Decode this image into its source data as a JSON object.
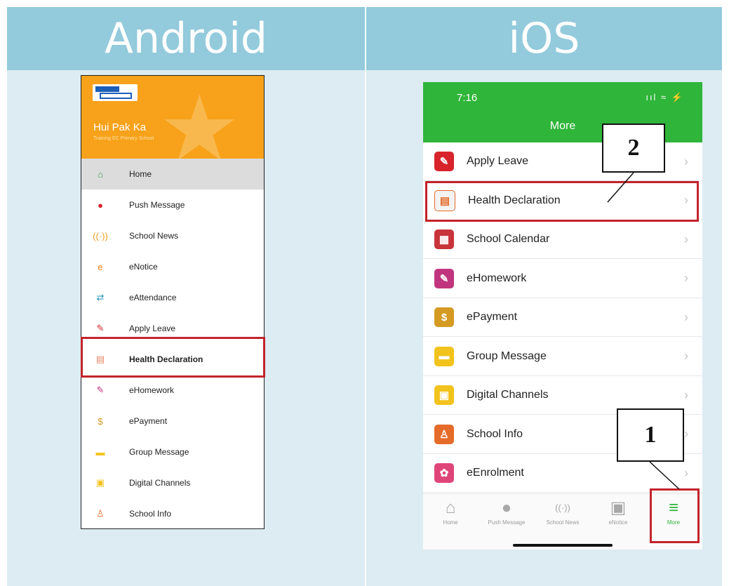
{
  "headers": {
    "android": "Android",
    "ios": "iOS"
  },
  "android": {
    "user_name": "Hui Pak Ka",
    "school_name": "Training EC Primary School",
    "menu": [
      {
        "label": "Home",
        "icon": "home-icon",
        "color": "#3aa655",
        "glyph": "⌂",
        "selected": true
      },
      {
        "label": "Push Message",
        "icon": "push-message-icon",
        "color": "#d8232a",
        "glyph": "●"
      },
      {
        "label": "School News",
        "icon": "school-news-icon",
        "color": "#f0a020",
        "glyph": "((·))"
      },
      {
        "label": "eNotice",
        "icon": "enotice-icon",
        "color": "#f07a1a",
        "glyph": "e"
      },
      {
        "label": "eAttendance",
        "icon": "eattendance-icon",
        "color": "#1f8fb5",
        "glyph": "⇄"
      },
      {
        "label": "Apply Leave",
        "icon": "apply-leave-icon",
        "color": "#d8232a",
        "glyph": "✎"
      },
      {
        "label": "Health Declaration",
        "icon": "health-declaration-icon",
        "color": "#e8876a",
        "glyph": "▤",
        "highlighted": true
      },
      {
        "label": "eHomework",
        "icon": "ehomework-icon",
        "color": "#c0357e",
        "glyph": "✎"
      },
      {
        "label": "ePayment",
        "icon": "epayment-icon",
        "color": "#d49a22",
        "glyph": "$"
      },
      {
        "label": "Group Message",
        "icon": "group-message-icon",
        "color": "#f2c31d",
        "glyph": "▬"
      },
      {
        "label": "Digital Channels",
        "icon": "digital-channels-icon",
        "color": "#f2c31d",
        "glyph": "▣"
      },
      {
        "label": "School Info",
        "icon": "school-info-icon",
        "color": "#e56b2a",
        "glyph": "♙"
      }
    ]
  },
  "ios": {
    "time": "7:16",
    "status_icons": "ııl ≈ ⚡",
    "title": "More",
    "rows": [
      {
        "label": "Apply Leave",
        "icon": "apply-leave-icon",
        "color": "#d8232a",
        "glyph": "✎"
      },
      {
        "label": "Health Declaration",
        "icon": "health-declaration-icon",
        "color": "#f3f3f3",
        "glyph": "▤",
        "highlighted": true
      },
      {
        "label": "School Calendar",
        "icon": "school-calendar-icon",
        "color": "#c7343a",
        "glyph": "▦"
      },
      {
        "label": "eHomework",
        "icon": "ehomework-icon",
        "color": "#c0357e",
        "glyph": "✎"
      },
      {
        "label": "ePayment",
        "icon": "epayment-icon",
        "color": "#d49a22",
        "glyph": "$"
      },
      {
        "label": "Group Message",
        "icon": "group-message-icon",
        "color": "#f2c31d",
        "glyph": "▬"
      },
      {
        "label": "Digital Channels",
        "icon": "digital-channels-icon",
        "color": "#f2c31d",
        "glyph": "▣"
      },
      {
        "label": "School Info",
        "icon": "school-info-icon",
        "color": "#e56b2a",
        "glyph": "♙"
      },
      {
        "label": "eEnrolment",
        "icon": "eenrolment-icon",
        "color": "#e0457a",
        "glyph": "✿"
      }
    ],
    "tabs": [
      {
        "label": "Home",
        "icon": "home-icon",
        "glyph": "⌂"
      },
      {
        "label": "Push Message",
        "icon": "push-message-icon",
        "glyph": "●"
      },
      {
        "label": "School News",
        "icon": "school-news-icon",
        "glyph": "((·))"
      },
      {
        "label": "eNotice",
        "icon": "enotice-icon",
        "glyph": "▣"
      },
      {
        "label": "More",
        "icon": "more-menu-icon",
        "glyph": "≡",
        "active": true
      }
    ]
  },
  "callouts": {
    "step1": "1",
    "step2": "2"
  },
  "colors": {
    "header_bg": "#93cadc",
    "android_accent": "#f7a21a",
    "ios_accent": "#2fb53a",
    "highlight": "#c3242c"
  }
}
